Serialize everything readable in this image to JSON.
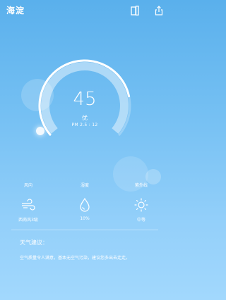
{
  "header": {
    "location": "海淀"
  },
  "air": {
    "aqi": "45",
    "level": "优",
    "pm25": "PM 2.5 : 12",
    "gauge_fraction": 0.8
  },
  "stats": [
    {
      "label": "风向",
      "value": "西南风3级",
      "icon": "wind-icon"
    },
    {
      "label": "湿度",
      "value": "10%",
      "icon": "water-drop-icon"
    },
    {
      "label": "紫外线",
      "value": "中等",
      "icon": "sun-icon"
    }
  ],
  "advice": {
    "title": "天气建议：",
    "text": "空气质量令人满意，基本无空气污染，建议您多出去走走。"
  },
  "colors": {
    "background_top": "#5ab0ec",
    "background_bottom": "#a2d8fd",
    "text": "#ffffff"
  }
}
